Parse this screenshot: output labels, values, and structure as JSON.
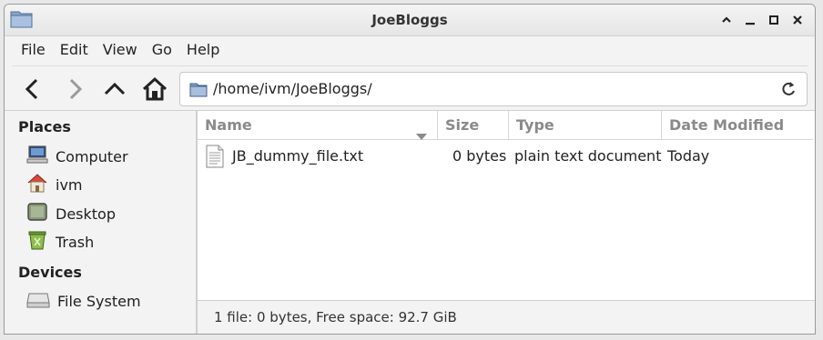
{
  "window": {
    "title": "JoeBloggs"
  },
  "menu": {
    "items": [
      "File",
      "Edit",
      "View",
      "Go",
      "Help"
    ]
  },
  "location": {
    "path": "/home/ivm/JoeBloggs/"
  },
  "sidebar": {
    "places_heading": "Places",
    "places": [
      {
        "label": "Computer",
        "icon": "computer-icon"
      },
      {
        "label": "ivm",
        "icon": "home-icon"
      },
      {
        "label": "Desktop",
        "icon": "desktop-icon"
      },
      {
        "label": "Trash",
        "icon": "trash-icon"
      }
    ],
    "devices_heading": "Devices",
    "devices": [
      {
        "label": "File System",
        "icon": "drive-icon"
      }
    ]
  },
  "columns": {
    "name": "Name",
    "size": "Size",
    "type": "Type",
    "date": "Date Modified"
  },
  "files": [
    {
      "name": "JB_dummy_file.txt",
      "size": "0 bytes",
      "type": "plain text document",
      "date": "Today",
      "icon": "text-file-icon"
    }
  ],
  "status": {
    "text": "1 file: 0 bytes, Free space: 92.7 GiB"
  }
}
